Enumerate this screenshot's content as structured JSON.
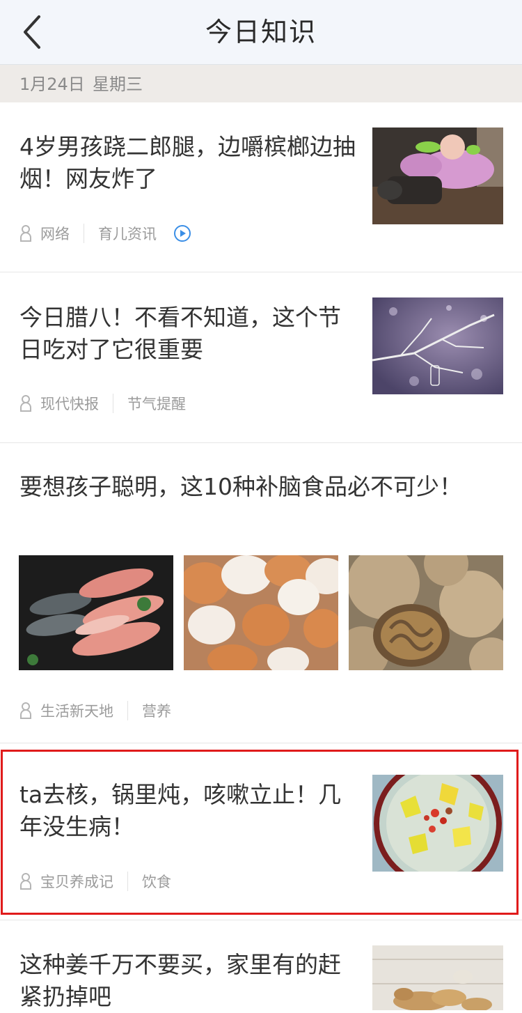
{
  "header": {
    "title": "今日知识",
    "back_icon": "chevron-left-icon"
  },
  "date_bar": {
    "date": "1月24日",
    "weekday": "星期三"
  },
  "articles": [
    {
      "title": "4岁男孩跷二郎腿，边嚼槟榔边抽烟！网友炸了",
      "source": "网络",
      "category": "育儿资讯",
      "has_video": true,
      "thumbnail": "photo of child in pink jacket lying down"
    },
    {
      "title": "今日腊八！不看不知道，这个节日吃对了它很重要",
      "source": "现代快报",
      "category": "节气提醒",
      "thumbnail": "frosted branches with bokeh"
    },
    {
      "title": "要想孩子聪明，这10种补脑食品必不可少！",
      "source": "生活新天地",
      "category": "营养",
      "images": [
        "fish",
        "eggs",
        "walnuts"
      ]
    },
    {
      "title": "ta去核，锅里炖，咳嗽立止！几年没生病！",
      "source": "宝贝养成记",
      "category": "饮食",
      "highlighted": true,
      "thumbnail": "bowl of pear soup with goji berries"
    },
    {
      "title": "这种姜千万不要买，家里有的赶紧扔掉吧",
      "thumbnail": "ginger roots on wooden table"
    }
  ],
  "colors": {
    "header_bg": "#f3f6fb",
    "date_bar_bg": "#eeebe8",
    "highlight_border": "#e01b1b",
    "meta_text": "#9b9b9b",
    "play_icon": "#3a8ee6"
  }
}
